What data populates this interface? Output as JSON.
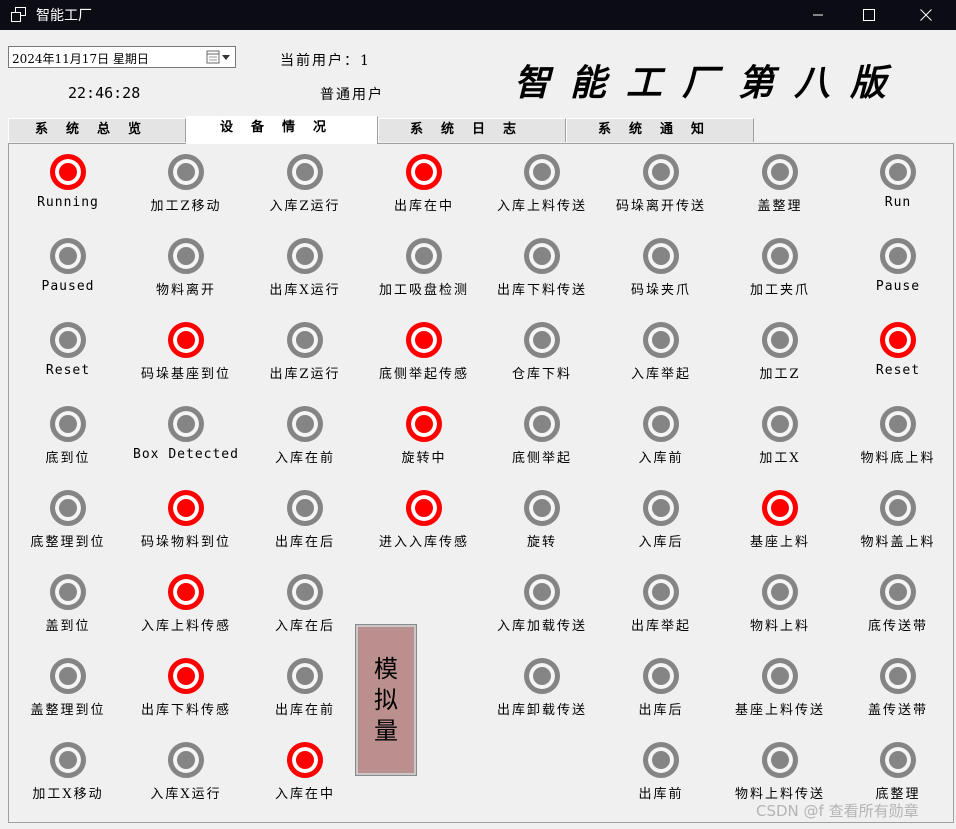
{
  "window": {
    "title": "智能工厂"
  },
  "header": {
    "date": "2024年11月17日  星期日",
    "time": "22:46:28",
    "current_user_label": "当前用户：1",
    "user_type": "普通用户",
    "big_title": "智能工厂第八版"
  },
  "tabs": [
    {
      "label": "系统总览",
      "active": false
    },
    {
      "label": "设备情况",
      "active": true
    },
    {
      "label": "系统日志",
      "active": false
    },
    {
      "label": "系统通知",
      "active": false
    }
  ],
  "indicators": [
    {
      "label": "Running",
      "on": true,
      "col": 0,
      "row": 0
    },
    {
      "label": "Paused",
      "on": false,
      "col": 0,
      "row": 1
    },
    {
      "label": "Reset",
      "on": false,
      "col": 0,
      "row": 2
    },
    {
      "label": "底到位",
      "on": false,
      "col": 0,
      "row": 3
    },
    {
      "label": "底整理到位",
      "on": false,
      "col": 0,
      "row": 4
    },
    {
      "label": "盖到位",
      "on": false,
      "col": 0,
      "row": 5
    },
    {
      "label": "盖整理到位",
      "on": false,
      "col": 0,
      "row": 6
    },
    {
      "label": "加工X移动",
      "on": false,
      "col": 0,
      "row": 7
    },
    {
      "label": "加工Z移动",
      "on": false,
      "col": 1,
      "row": 0
    },
    {
      "label": "物料离开",
      "on": false,
      "col": 1,
      "row": 1
    },
    {
      "label": "码垛基座到位",
      "on": true,
      "col": 1,
      "row": 2
    },
    {
      "label": "Box Detected",
      "on": false,
      "col": 1,
      "row": 3
    },
    {
      "label": "码垛物料到位",
      "on": true,
      "col": 1,
      "row": 4
    },
    {
      "label": "入库上料传感",
      "on": true,
      "col": 1,
      "row": 5
    },
    {
      "label": "出库下料传感",
      "on": true,
      "col": 1,
      "row": 6
    },
    {
      "label": "入库X运行",
      "on": false,
      "col": 1,
      "row": 7
    },
    {
      "label": "入库Z运行",
      "on": false,
      "col": 2,
      "row": 0
    },
    {
      "label": "出库X运行",
      "on": false,
      "col": 2,
      "row": 1
    },
    {
      "label": "出库Z运行",
      "on": false,
      "col": 2,
      "row": 2
    },
    {
      "label": "入库在前",
      "on": false,
      "col": 2,
      "row": 3
    },
    {
      "label": "出库在后",
      "on": false,
      "col": 2,
      "row": 4
    },
    {
      "label": "入库在后",
      "on": false,
      "col": 2,
      "row": 5
    },
    {
      "label": "出库在前",
      "on": false,
      "col": 2,
      "row": 6
    },
    {
      "label": "入库在中",
      "on": true,
      "col": 2,
      "row": 7
    },
    {
      "label": "出库在中",
      "on": true,
      "col": 3,
      "row": 0
    },
    {
      "label": "加工吸盘检测",
      "on": false,
      "col": 3,
      "row": 1
    },
    {
      "label": "底侧举起传感",
      "on": true,
      "col": 3,
      "row": 2
    },
    {
      "label": "旋转中",
      "on": true,
      "col": 3,
      "row": 3
    },
    {
      "label": "进入入库传感",
      "on": true,
      "col": 3,
      "row": 4
    },
    {
      "label": "入库上料传送",
      "on": false,
      "col": 4,
      "row": 0
    },
    {
      "label": "出库下料传送",
      "on": false,
      "col": 4,
      "row": 1
    },
    {
      "label": "仓库下料",
      "on": false,
      "col": 4,
      "row": 2
    },
    {
      "label": "底侧举起",
      "on": false,
      "col": 4,
      "row": 3
    },
    {
      "label": "旋转",
      "on": false,
      "col": 4,
      "row": 4
    },
    {
      "label": "入库加载传送",
      "on": false,
      "col": 4,
      "row": 5
    },
    {
      "label": "出库卸载传送",
      "on": false,
      "col": 4,
      "row": 6
    },
    {
      "label": "码垛离开传送",
      "on": false,
      "col": 5,
      "row": 0
    },
    {
      "label": "码垛夹爪",
      "on": false,
      "col": 5,
      "row": 1
    },
    {
      "label": "入库举起",
      "on": false,
      "col": 5,
      "row": 2
    },
    {
      "label": "入库前",
      "on": false,
      "col": 5,
      "row": 3
    },
    {
      "label": "入库后",
      "on": false,
      "col": 5,
      "row": 4
    },
    {
      "label": "出库举起",
      "on": false,
      "col": 5,
      "row": 5
    },
    {
      "label": "出库后",
      "on": false,
      "col": 5,
      "row": 6
    },
    {
      "label": "出库前",
      "on": false,
      "col": 5,
      "row": 7
    },
    {
      "label": "盖整理",
      "on": false,
      "col": 6,
      "row": 0
    },
    {
      "label": "加工夹爪",
      "on": false,
      "col": 6,
      "row": 1
    },
    {
      "label": "加工Z",
      "on": false,
      "col": 6,
      "row": 2
    },
    {
      "label": "加工X",
      "on": false,
      "col": 6,
      "row": 3
    },
    {
      "label": "基座上料",
      "on": true,
      "col": 6,
      "row": 4
    },
    {
      "label": "物料上料",
      "on": false,
      "col": 6,
      "row": 5
    },
    {
      "label": "基座上料传送",
      "on": false,
      "col": 6,
      "row": 6
    },
    {
      "label": "物料上料传送",
      "on": false,
      "col": 6,
      "row": 7
    },
    {
      "label": "Run",
      "on": false,
      "col": 7,
      "row": 0
    },
    {
      "label": "Pause",
      "on": false,
      "col": 7,
      "row": 1
    },
    {
      "label": "Reset",
      "on": true,
      "col": 7,
      "row": 2
    },
    {
      "label": "物料底上料",
      "on": false,
      "col": 7,
      "row": 3
    },
    {
      "label": "物料盖上料",
      "on": false,
      "col": 7,
      "row": 4
    },
    {
      "label": "底传送带",
      "on": false,
      "col": 7,
      "row": 5
    },
    {
      "label": "盖传送带",
      "on": false,
      "col": 7,
      "row": 6
    },
    {
      "label": "底整理",
      "on": false,
      "col": 7,
      "row": 7
    }
  ],
  "analog_button": {
    "chars": [
      "模",
      "拟",
      "量"
    ]
  },
  "watermark": "CSDN @f 查看所有勋章",
  "colors": {
    "lamp_on": "#ff0000",
    "lamp_off": "#858585",
    "analog_button_bg": "#bc8f8f",
    "titlebar_bg": "#0c0c14"
  }
}
